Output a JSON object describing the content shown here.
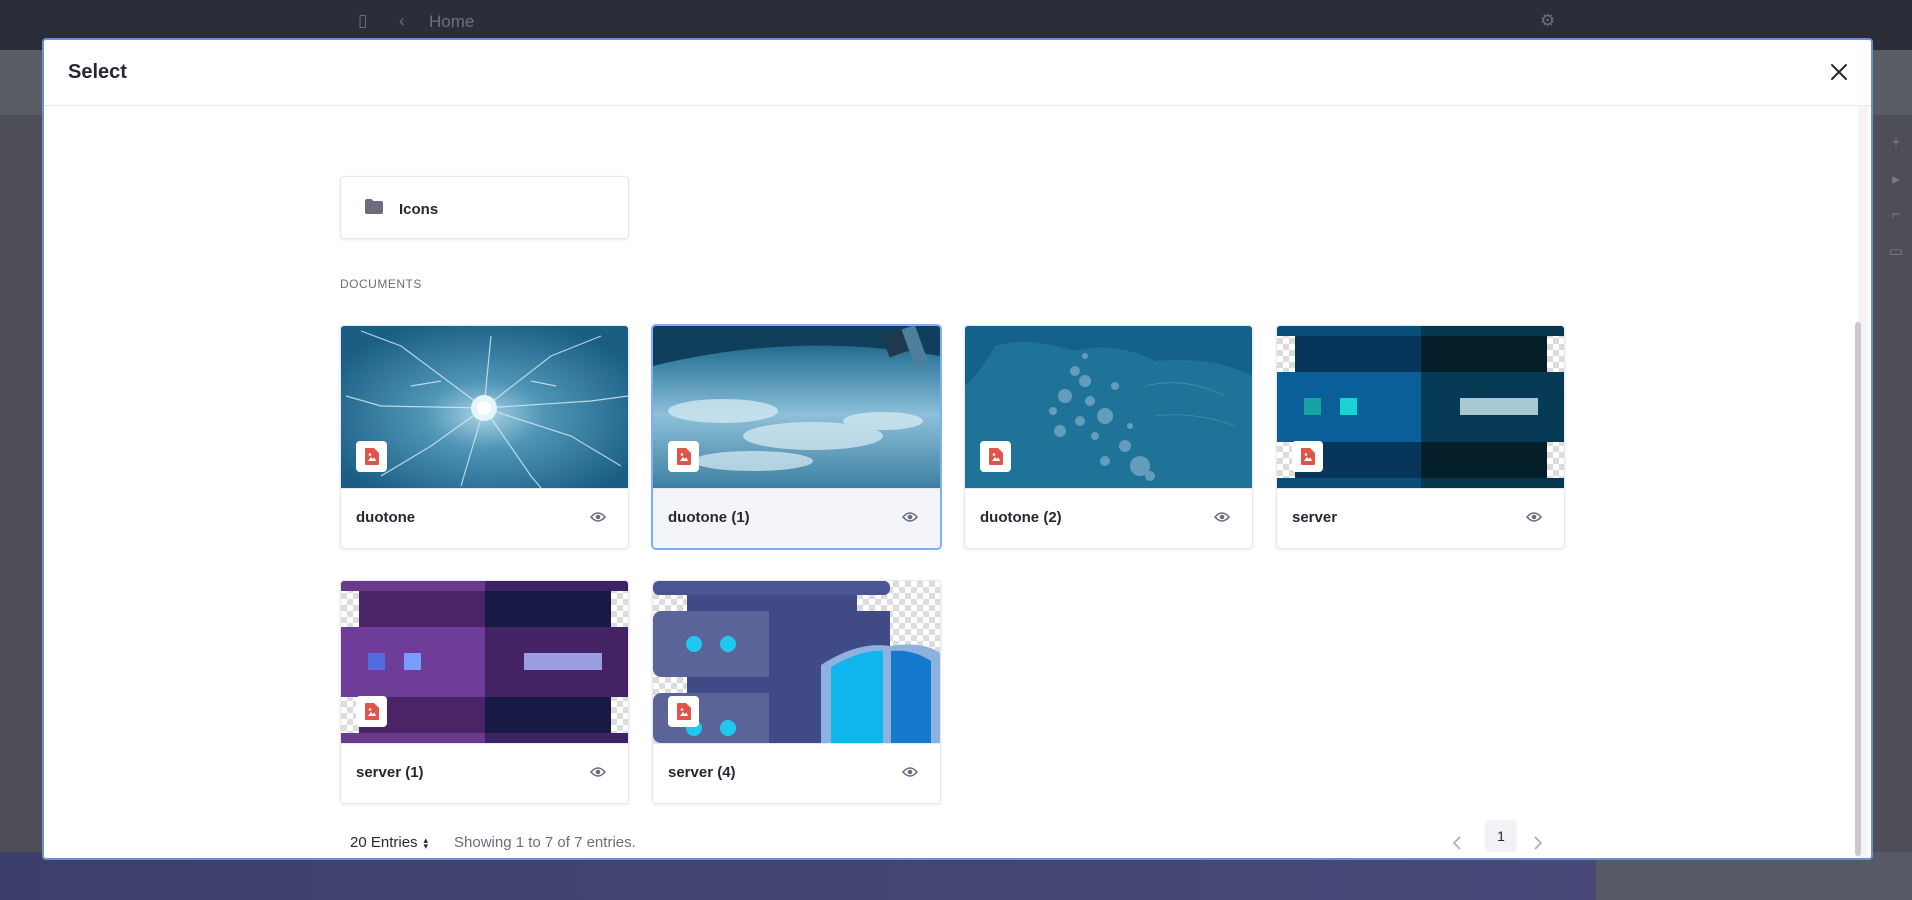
{
  "background": {
    "breadcrumb": "Home"
  },
  "modal": {
    "title": "Select",
    "folder": {
      "name": "Icons"
    },
    "section_label": "DOCUMENTS",
    "documents": [
      {
        "title": "duotone"
      },
      {
        "title": "duotone (1)"
      },
      {
        "title": "duotone (2)"
      },
      {
        "title": "server"
      },
      {
        "title": "server (1)"
      },
      {
        "title": "server (4)"
      }
    ],
    "pagination": {
      "entries_label": "20 Entries",
      "showing": "Showing 1 to 7 of 7 entries.",
      "current_page": "1"
    }
  },
  "colors": {
    "accent_border": "#80acff",
    "file_badge": "#e0554b"
  },
  "icons": {
    "folder": "folder-icon",
    "close": "close-icon",
    "preview": "eye-icon",
    "file_type": "image-file-icon"
  }
}
